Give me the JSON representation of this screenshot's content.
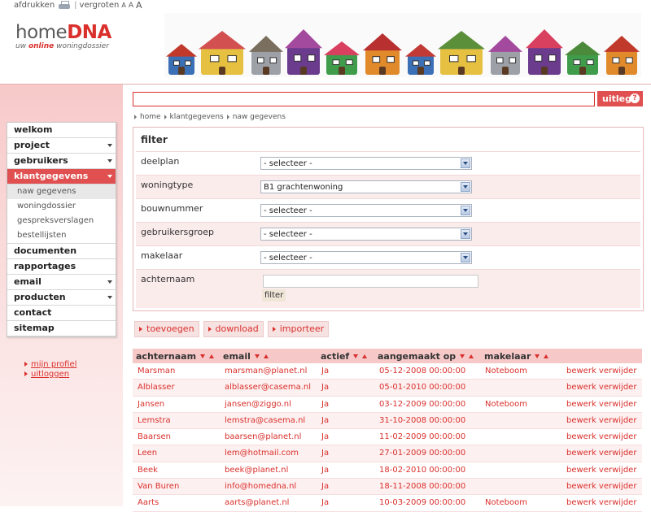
{
  "toplinks": {
    "print": "afdrukken",
    "separator": "|",
    "zoom": "vergroten",
    "sizes": [
      "A",
      "A",
      "A"
    ]
  },
  "logo": {
    "home": "home",
    "dna": "DNA",
    "sub_prefix": "uw ",
    "sub_online": "online",
    "sub_suffix": " woningdossier"
  },
  "search": {
    "placeholder": ""
  },
  "help_button": {
    "label": "uitleg",
    "icon": "?"
  },
  "breadcrumb": [
    "home",
    "klantgegevens",
    "naw gegevens"
  ],
  "sidebar": {
    "menu": [
      {
        "label": "welkom",
        "arrow": false
      },
      {
        "label": "project",
        "arrow": true
      },
      {
        "label": "gebruikers",
        "arrow": true
      },
      {
        "label": "klantgegevens",
        "arrow": true,
        "active": true
      }
    ],
    "submenu": [
      "naw gegevens",
      "woningdossier",
      "gespreksverslagen",
      "bestellijsten"
    ],
    "menu2": [
      {
        "label": "documenten",
        "arrow": false
      },
      {
        "label": "rapportages",
        "arrow": false
      },
      {
        "label": "email",
        "arrow": true
      },
      {
        "label": "producten",
        "arrow": true
      },
      {
        "label": "contact",
        "arrow": false
      },
      {
        "label": "sitemap",
        "arrow": false
      }
    ],
    "links": [
      "mijn profiel",
      "uitloggen"
    ]
  },
  "filter": {
    "title": "filter",
    "rows": [
      {
        "label": "deelplan",
        "value": "- selecteer -"
      },
      {
        "label": "woningtype",
        "value": "B1 grachtenwoning"
      },
      {
        "label": "bouwnummer",
        "value": "- selecteer -"
      },
      {
        "label": "gebruikersgroep",
        "value": "- selecteer -"
      },
      {
        "label": "makelaar",
        "value": "- selecteer -"
      }
    ],
    "text_label": "achternaam",
    "text_value": "",
    "button": "filter"
  },
  "actions": [
    "toevoegen",
    "download",
    "importeer"
  ],
  "table": {
    "columns": [
      "achternaam",
      "email",
      "actief",
      "aangemaakt op",
      "makelaar"
    ],
    "rows": [
      {
        "achternaam": "Marsman",
        "email": "marsman@planet.nl",
        "actief": "Ja",
        "aangemaakt": "05-12-2008 00:00:00",
        "makelaar": "Noteboom"
      },
      {
        "achternaam": "Alblasser",
        "email": "alblasser@casema.nl",
        "actief": "Ja",
        "aangemaakt": "05-01-2010 00:00:00",
        "makelaar": ""
      },
      {
        "achternaam": "Jansen",
        "email": "jansen@ziggo.nl",
        "actief": "Ja",
        "aangemaakt": "03-12-2009 00:00:00",
        "makelaar": "Noteboom"
      },
      {
        "achternaam": "Lemstra",
        "email": "lemstra@casema.nl",
        "actief": "Ja",
        "aangemaakt": "31-10-2008 00:00:00",
        "makelaar": ""
      },
      {
        "achternaam": "Baarsen",
        "email": "baarsen@planet.nl",
        "actief": "Ja",
        "aangemaakt": "11-02-2009 00:00:00",
        "makelaar": ""
      },
      {
        "achternaam": "Leen",
        "email": "lem@hotmail.com",
        "actief": "Ja",
        "aangemaakt": "27-01-2009 00:00:00",
        "makelaar": ""
      },
      {
        "achternaam": "Beek",
        "email": "beek@planet.nl",
        "actief": "Ja",
        "aangemaakt": "18-02-2010 00:00:00",
        "makelaar": ""
      },
      {
        "achternaam": "Van Buren",
        "email": "info@homedna.nl",
        "actief": "Ja",
        "aangemaakt": "18-11-2008 00:00:00",
        "makelaar": ""
      },
      {
        "achternaam": "Aarts",
        "email": "aarts@planet.nl",
        "actief": "Ja",
        "aangemaakt": "10-03-2009 00:00:00",
        "makelaar": "Noteboom"
      }
    ],
    "edit_label": "bewerk",
    "delete_label": "verwijder"
  },
  "banner": {
    "roof_colors": [
      "#c0392b",
      "#d35050",
      "#7a6e5e",
      "#a44a9e",
      "#d94060",
      "#b83030",
      "#c23a35",
      "#5b8f3a",
      "#a44a9e",
      "#d94060",
      "#4b8a3a",
      "#c0392b"
    ],
    "wall_colors": [
      "#3b6fb6",
      "#e6c040",
      "#9ea0a8",
      "#6b3b8e",
      "#3f9c4a",
      "#e08a2c",
      "#3b6fb6",
      "#e6c040",
      "#9ea0a8",
      "#6b3b8e",
      "#3f9c4a",
      "#e08a2c"
    ]
  }
}
